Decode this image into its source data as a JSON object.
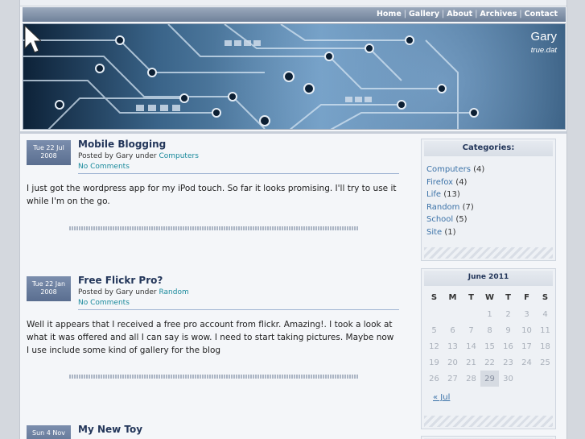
{
  "site": {
    "title": "Gary",
    "description": "true.dat"
  },
  "nav": {
    "items": [
      "Home",
      "Gallery",
      "About",
      "Archives",
      "Contact"
    ],
    "separator": "|"
  },
  "posts": [
    {
      "date_line1": "Tue 22 Jul",
      "date_line2": "2008",
      "title": "Mobile Blogging",
      "meta_prefix": "Posted by Gary under",
      "category": "Computers",
      "comments": "No Comments",
      "body": "I just got the wordpress app for my iPod touch. So far it looks promising. I'll try to use it while I'm on the go."
    },
    {
      "date_line1": "Tue 22 Jan",
      "date_line2": "2008",
      "title": "Free Flickr Pro?",
      "meta_prefix": "Posted by Gary under",
      "category": "Random",
      "comments": "No Comments",
      "body": "Well it appears that I received a free pro account from flickr. Amazing!. I took a look at what it was offered and all I can say is wow. I need to start taking pictures. Maybe now I use include some kind of gallery for the blog"
    },
    {
      "date_line1": "Sun 4 Nov",
      "title": "My New Toy"
    }
  ],
  "sidebar": {
    "categories": {
      "heading": "Categories:",
      "items": [
        {
          "name": "Computers",
          "count": "(4)"
        },
        {
          "name": "Firefox",
          "count": "(4)"
        },
        {
          "name": "Life",
          "count": "(13)"
        },
        {
          "name": "Random",
          "count": "(7)"
        },
        {
          "name": "School",
          "count": "(5)"
        },
        {
          "name": "Site",
          "count": "(1)"
        }
      ]
    },
    "calendar": {
      "heading": "June 2011",
      "weekdays": [
        "S",
        "M",
        "T",
        "W",
        "T",
        "F",
        "S"
      ],
      "weeks": [
        [
          "",
          "",
          "",
          "1",
          "2",
          "3",
          "4"
        ],
        [
          "5",
          "6",
          "7",
          "8",
          "9",
          "10",
          "11"
        ],
        [
          "12",
          "13",
          "14",
          "15",
          "16",
          "17",
          "18"
        ],
        [
          "19",
          "20",
          "21",
          "22",
          "23",
          "24",
          "25"
        ],
        [
          "26",
          "27",
          "28",
          "29",
          "30",
          "",
          ""
        ]
      ],
      "today": "29",
      "prev_link": "« Jul"
    }
  }
}
